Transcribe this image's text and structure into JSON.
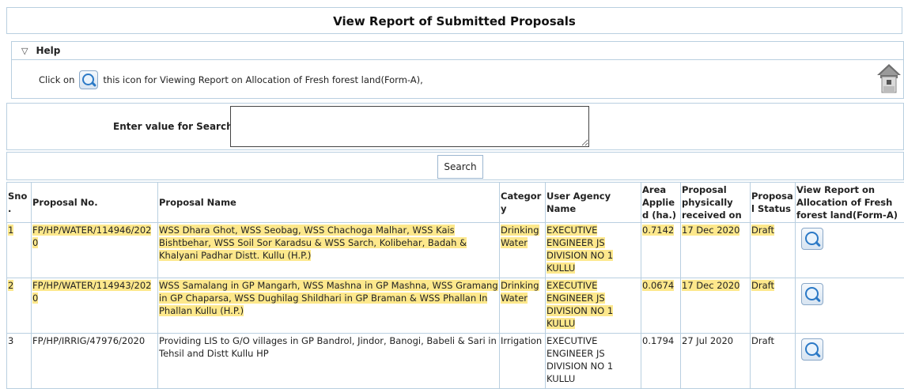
{
  "page": {
    "title": "View Report of Submitted Proposals"
  },
  "help": {
    "toggle_symbol": "▽",
    "title": "Help",
    "text_before": "Click on",
    "text_after": "this icon for Viewing Report on Allocation of Fresh forest land(Form-A),"
  },
  "search": {
    "label": "Enter value for Search :",
    "value": "",
    "button": "Search"
  },
  "table": {
    "headers": [
      "Sno.",
      "Proposal No.",
      "Proposal Name",
      "Category",
      "User Agency Name",
      "Area Applied (ha.)",
      "Proposal physically received on",
      "Proposal Status",
      "View Report on Allocation of Fresh forest land(Form-A)"
    ],
    "rows": [
      {
        "sno": "1",
        "proposal_no": "FP/HP/WATER/114946/2020",
        "name": "WSS Dhara Ghot, WSS Seobag, WSS Chachoga Malhar, WSS Kais Bishtbehar, WSS Soil Sor Karadsu & WSS Sarch, Kolibehar, Badah & Khalyani Padhar Distt. Kullu (H.P.)",
        "category": "Drinking Water",
        "agency": "EXECUTIVE ENGINEER JS DIVISION NO 1 KULLU",
        "area": "0.7142",
        "received": "17 Dec 2020",
        "status": "Draft"
      },
      {
        "sno": "2",
        "proposal_no": "FP/HP/WATER/114943/2020",
        "name": "WSS Samalang in GP Mangarh, WSS Mashna in GP Mashna, WSS Gramang in GP Chaparsa, WSS Dughilag Shildhari in GP Braman & WSS Phallan In Phallan Kullu (H.P.)",
        "category": "Drinking Water",
        "agency": "EXECUTIVE ENGINEER JS DIVISION NO 1 KULLU",
        "area": "0.0674",
        "received": "17 Dec 2020",
        "status": "Draft"
      },
      {
        "sno": "3",
        "proposal_no": "FP/HP/IRRIG/47976/2020",
        "name": "Providing LIS to G/O villages in GP Bandrol, Jindor, Banogi, Babeli & Sari in Tehsil and Distt Kullu HP",
        "category": "Irrigation",
        "agency": "EXECUTIVE ENGINEER JS DIVISION NO 1 KULLU",
        "area": "0.1794",
        "received": "27 Jul 2020",
        "status": "Draft"
      }
    ]
  },
  "colors": {
    "highlight": "#fde88c",
    "border": "#b9cfe0",
    "icon_blue": "#2b79c6"
  }
}
